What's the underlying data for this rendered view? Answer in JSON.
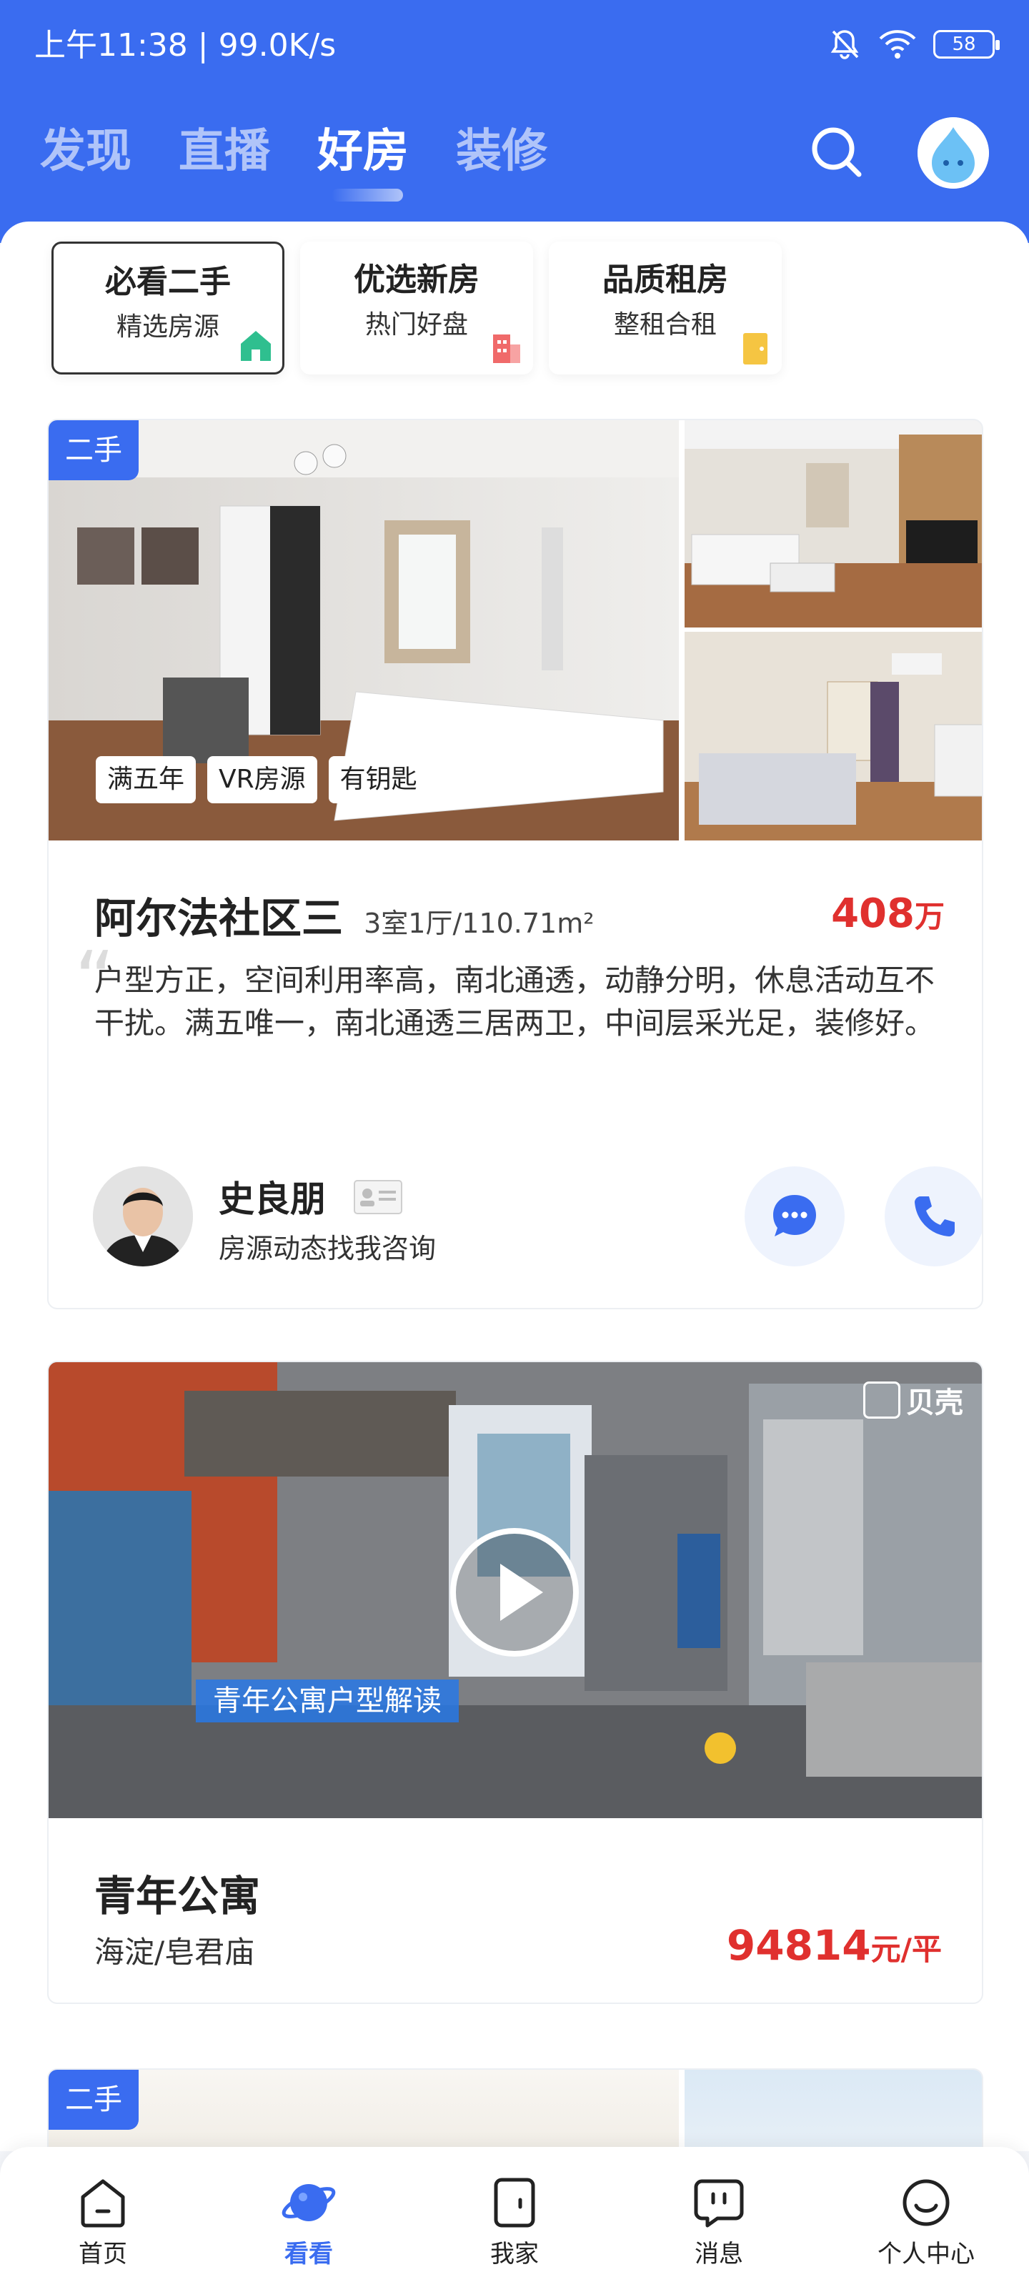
{
  "status_bar": {
    "time_speed": "上午11:38 | 99.0K/s",
    "battery": "58",
    "icons": [
      "mute-icon",
      "wifi-icon",
      "battery-icon"
    ]
  },
  "top_tabs": [
    {
      "label": "发现",
      "active": false
    },
    {
      "label": "直播",
      "active": false
    },
    {
      "label": "好房",
      "active": true
    },
    {
      "label": "装修",
      "active": false
    }
  ],
  "quick_entries": [
    {
      "title": "必看二手",
      "subtitle": "精选房源",
      "icon": "house-icon",
      "color": "#2fbf8f"
    },
    {
      "title": "优选新房",
      "subtitle": "热门好盘",
      "icon": "building-icon",
      "color": "#f06a6a"
    },
    {
      "title": "品质租房",
      "subtitle": "整租合租",
      "icon": "door-icon",
      "color": "#f5c542"
    }
  ],
  "listing1": {
    "badge": "二手",
    "tags": [
      "满五年",
      "VR房源",
      "有钥匙"
    ],
    "title": "阿尔法社区三",
    "spec": "3室1厅/110.71m²",
    "price_value": "408",
    "price_unit": "万",
    "description": "户型方正，空间利用率高，南北通透，动静分明，休息活动互不干扰。满五唯一，南北通透三居两卫，中间层采光足，装修好。",
    "agent": {
      "name": "史良朋",
      "subtitle": "房源动态找我咨询"
    }
  },
  "listing2": {
    "video_caption": "青年公寓户型解读",
    "video_logo": "贝壳",
    "title": "青年公寓",
    "location": "海淀/皂君庙",
    "price_value": "94814",
    "price_unit": "元/平"
  },
  "listing3": {
    "badge": "二手"
  },
  "bottom_nav": [
    {
      "label": "首页",
      "icon": "home-icon",
      "active": false
    },
    {
      "label": "看看",
      "icon": "planet-icon",
      "active": true
    },
    {
      "label": "我家",
      "icon": "door-icon",
      "active": false
    },
    {
      "label": "消息",
      "icon": "message-icon",
      "active": false
    },
    {
      "label": "个人中心",
      "icon": "profile-icon",
      "active": false
    }
  ],
  "colors": {
    "brand_blue": "#3a6cf0",
    "price_red": "#e0302e"
  }
}
